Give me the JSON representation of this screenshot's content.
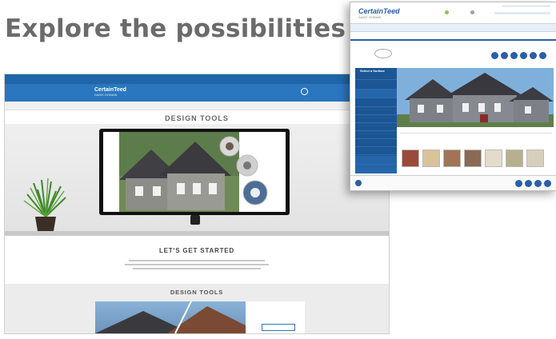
{
  "headline": "Explore the possibilities",
  "website": {
    "topbar_links": [
      "",
      "",
      "",
      "",
      ""
    ],
    "logo": "CertainTeed",
    "logo_sub": "SAINT-GOBAIN",
    "nav_items": [
      "",
      "",
      "",
      "",
      ""
    ],
    "breadcrumb": "",
    "hero_title": "DESIGN TOOLS",
    "section1_heading": "LET'S GET STARTED",
    "section2_heading": "DESIGN TOOLS",
    "card_text": "",
    "card_button": ""
  },
  "app": {
    "logo": "CertainTeed",
    "logo_sub": "SAINT-GOBAIN",
    "nav_items": [
      "",
      "",
      "",
      ""
    ],
    "welcome": "",
    "sidebar_title": "Select a Surface",
    "sidebar_items": [
      "",
      "",
      "",
      "",
      "",
      "",
      "",
      "",
      "",
      "",
      "",
      "",
      ""
    ],
    "swatch_title": "",
    "swatches": [
      {
        "label": "",
        "color": "#9a4a3a"
      },
      {
        "label": "",
        "color": "#d9c39a"
      },
      {
        "label": "",
        "color": "#a07456"
      },
      {
        "label": "",
        "color": "#8a6a55"
      },
      {
        "label": "",
        "color": "#e4dccb"
      },
      {
        "label": "",
        "color": "#b7b08d"
      },
      {
        "label": "",
        "color": "#d8cfbb"
      }
    ],
    "footer_left": "",
    "footer_right": ""
  },
  "colors": {
    "brand_blue": "#2a77c0",
    "app_blue": "#1c5694",
    "headline_gray": "#6b6b6b"
  }
}
